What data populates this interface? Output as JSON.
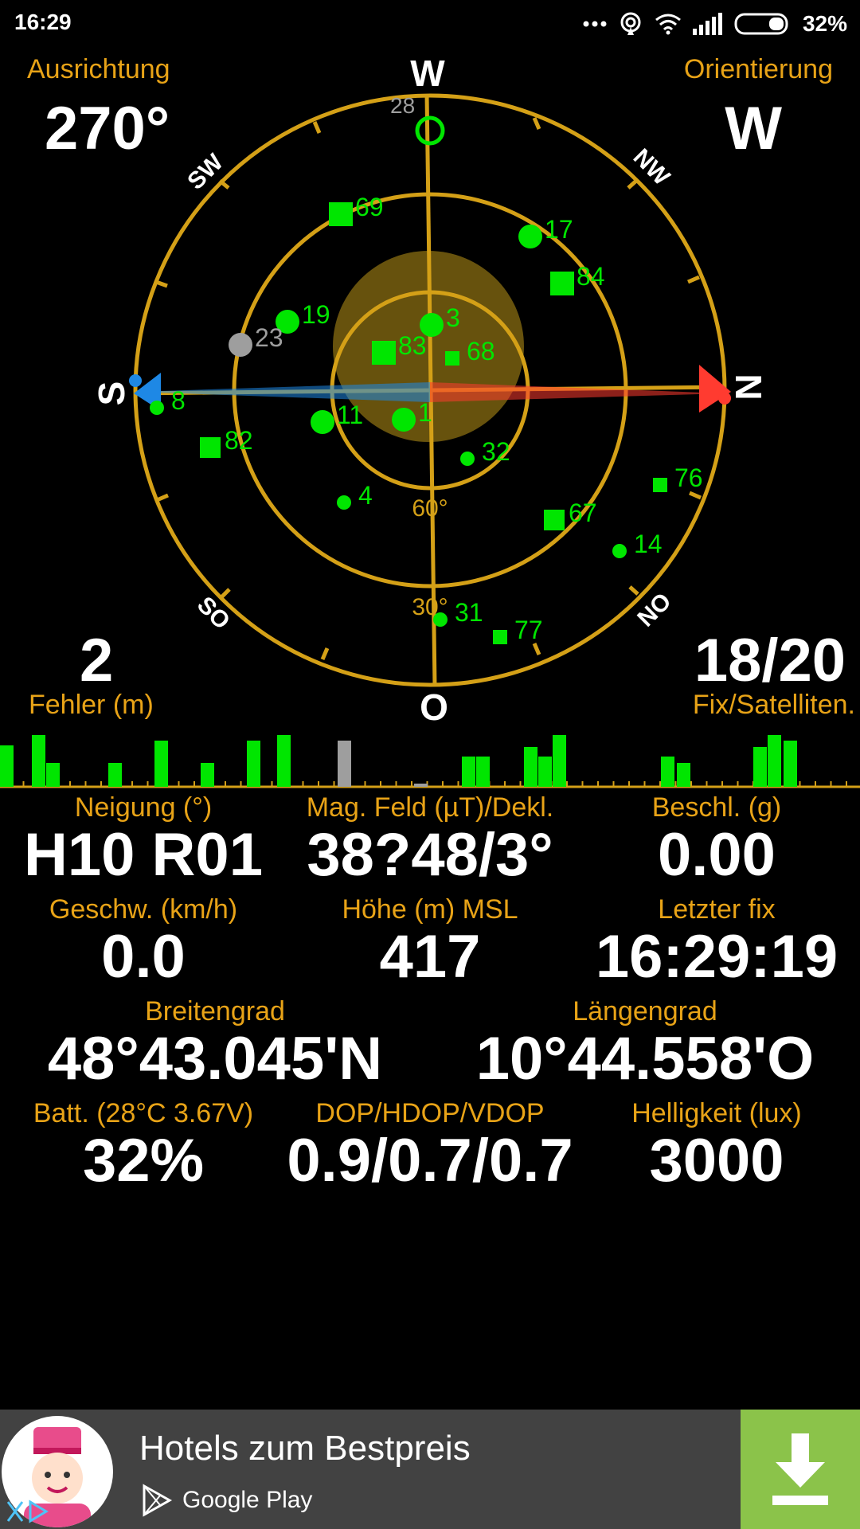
{
  "status_bar": {
    "time": "16:29",
    "battery": "32%",
    "icons": [
      "dots-icon",
      "hotspot-icon",
      "wifi-icon",
      "signal-icon",
      "battery-icon"
    ]
  },
  "compass": {
    "heading_label": "Ausrichtung",
    "heading_value": "270°",
    "orientation_label": "Orientierung",
    "orientation_value": "W",
    "error_value": "2",
    "error_label": "Fehler (m)",
    "fix_value": "18/20",
    "fix_label": "Fix/Satelliten.",
    "directions": {
      "top": "W",
      "bottom": "O",
      "left": "S",
      "right": "N",
      "nw": "NW",
      "sw": "SW",
      "so": "SO",
      "no": "NO"
    },
    "ring_labels": [
      "60°",
      "30°"
    ],
    "colors": {
      "ring": "#d4a017",
      "sat_used": "#00e600",
      "sat_unused": "#9e9e9e",
      "needle_north": "#ff3b30",
      "needle_south": "#1e88e5"
    },
    "satellites": [
      {
        "id": "28",
        "used": false,
        "shape": "ring"
      },
      {
        "id": "69",
        "used": true,
        "shape": "square"
      },
      {
        "id": "17",
        "used": true,
        "shape": "circle"
      },
      {
        "id": "84",
        "used": true,
        "shape": "square"
      },
      {
        "id": "19",
        "used": true,
        "shape": "circle"
      },
      {
        "id": "23",
        "used": false,
        "shape": "circle"
      },
      {
        "id": "3",
        "used": true,
        "shape": "circle"
      },
      {
        "id": "83",
        "used": true,
        "shape": "square"
      },
      {
        "id": "68",
        "used": true,
        "shape": "square"
      },
      {
        "id": "8",
        "used": true,
        "shape": "circle"
      },
      {
        "id": "11",
        "used": true,
        "shape": "circle"
      },
      {
        "id": "1",
        "used": true,
        "shape": "circle"
      },
      {
        "id": "82",
        "used": true,
        "shape": "square"
      },
      {
        "id": "32",
        "used": true,
        "shape": "circle"
      },
      {
        "id": "76",
        "used": true,
        "shape": "square"
      },
      {
        "id": "4",
        "used": true,
        "shape": "circle"
      },
      {
        "id": "67",
        "used": true,
        "shape": "square"
      },
      {
        "id": "14",
        "used": true,
        "shape": "circle"
      },
      {
        "id": "31",
        "used": true,
        "shape": "circle"
      },
      {
        "id": "77",
        "used": true,
        "shape": "square"
      }
    ]
  },
  "data": {
    "neigung_label": "Neigung (°)",
    "neigung_value": "H10 R01",
    "magfeld_label": "Mag. Feld (µT)/Dekl.",
    "magfeld_value": "38?48/3°",
    "beschl_label": "Beschl. (g)",
    "beschl_value": "0.00",
    "geschw_label": "Geschw. (km/h)",
    "geschw_value": "0.0",
    "hoehe_label": "Höhe (m) MSL",
    "hoehe_value": "417",
    "letzter_label": "Letzter fix",
    "letzter_value": "16:29:19",
    "breite_label": "Breitengrad",
    "breite_value": "48°43.045'N",
    "laenge_label": "Längengrad",
    "laenge_value": "10°44.558'O",
    "batt_label": "Batt. (28°C 3.67V)",
    "batt_value": "32%",
    "dop_label": "DOP/HDOP/VDOP",
    "dop_value": "0.9/0.7/0.7",
    "hell_label": "Helligkeit (lux)",
    "hell_value": "3000"
  },
  "ad": {
    "title": "Hotels zum Bestpreis",
    "store": "Google Play"
  }
}
